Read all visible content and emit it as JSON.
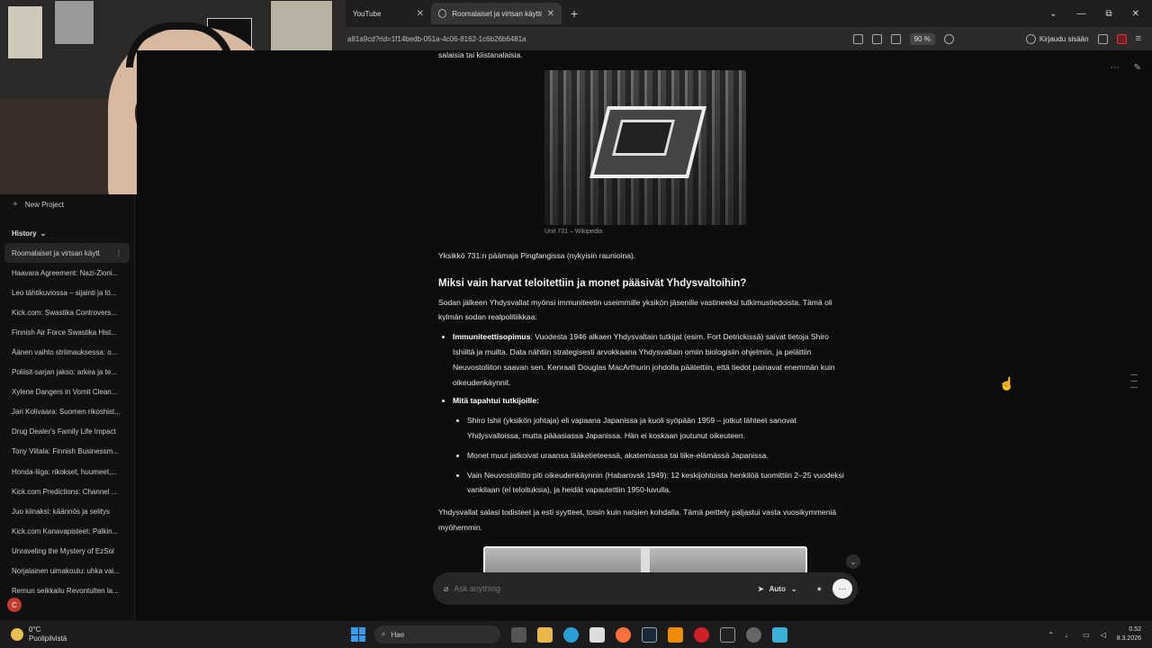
{
  "tabs": [
    {
      "label": "YouTube",
      "close": "✕"
    },
    {
      "label": "Roomalaiset ja virtsan käyttö s…",
      "close": "✕"
    }
  ],
  "newtab": "+",
  "window_controls": {
    "dropdown": "⌄",
    "minimize": "—",
    "maximize": "⧉",
    "close": "✕"
  },
  "address": {
    "url": "a81a9cd?rid=1f14bedb-051a-4c06-8162-1c6b26b6481a",
    "zoom": "90 %",
    "signin": "Kirjaudu sisään"
  },
  "sidebar": {
    "new_project": "New Project",
    "history_label": "History",
    "history_chevron": "⌄",
    "items": [
      {
        "label": "Roomalaiset ja virtsan käytt",
        "active": true
      },
      {
        "label": "Haavara Agreement: Nazi-Zioni..."
      },
      {
        "label": "Leo tähtikuviossa – sijainti ja lö..."
      },
      {
        "label": "Kick.com: Swastika Controvers..."
      },
      {
        "label": "Finnish Air Force Swastika Hist..."
      },
      {
        "label": "Äänen vaihto striimauksessa: o..."
      },
      {
        "label": "Poliisit-sarjan jakso: arkea ja te..."
      },
      {
        "label": "Xylene Dangers in Vomit Clean..."
      },
      {
        "label": "Jari Kolivaara: Suomen rikoshist..."
      },
      {
        "label": "Drug Dealer's Family Life Impact"
      },
      {
        "label": "Tony Viitala: Finnish Businessm..."
      },
      {
        "label": "Honda-liiga: rikokset, huumeet,..."
      },
      {
        "label": "Kick.com Predictions: Channel ..."
      },
      {
        "label": "Juo kiinaksi: käännös ja selitys"
      },
      {
        "label": "Kick.com Kanavapisteet: Palkin..."
      },
      {
        "label": "Unraveling the Mystery of EzSol"
      },
      {
        "label": "Norjalainen uimakoulu: uhka vai..."
      },
      {
        "label": "Remun seikkailu Revontulten la..."
      }
    ],
    "avatar_letter": "C",
    "more": "⋮"
  },
  "article": {
    "top_line": "salaisia tai kiistanalaisia.",
    "caption": "Unit 731 – Wikipedia",
    "p1": "Yksikkö 731:n päämaja Pingfangissa (nykyisin raunioina).",
    "h2": "Miksi vain harvat teloitettiin ja monet pääsivät Yhdysvaltoihin?",
    "p2": "Sodan jälkeen Yhdysvallat myönsi immuniteetin useimmille yksikön jäsenille vastineeksi tutkimustiedoista. Tämä oli kylmän sodan realpolitiikkaa:",
    "b1_title": "Immuniteettisopimus",
    "b1_text": ": Vuodesta 1946 alkaen Yhdysvaltain tutkijat (esim. Fort Detrickissä) saivat tietoja Shiro Ishiiltä ja muilta. Data nähtiin strategisesti arvokkaana Yhdysvaltain omiin biologisiin ohjelmiin, ja pelättiin Neuvostoliiton saavan sen. Kenraali Douglas MacArthurin johdolla päätettiin, että tiedot painavat enemmän kuin oikeudenkäynnit.",
    "b2_title": "Mitä tapahtui tutkijoille",
    "b2_colon": ":",
    "sub": [
      "Shiro Ishii (yksikön johtaja) eli vapaana Japanissa ja kuoli syöpään 1959 – jotkut lähteet sanovat Yhdysvalloissa, mutta pääasiassa Japanissa. Hän ei koskaan joutunut oikeuteen.",
      "Monet muut jatkoivat uraansa lääketieteessä, akatemiassa tai liike-elämässä Japanissa.",
      "Vain Neuvostoliitto piti oikeudenkäynnin (Habarovsk 1949): 12 keskijohtoista henkilöä tuomittiin 2–25 vuodeksi vankilaan (ei teloituksia), ja heidät vapautettiin 1950-luvulla."
    ],
    "p3": "Yhdysvallat salasi todisteet ja esti syytteet, toisin kuin natsien kohdalla. Tämä peittely paljastui vasta vuosikymmeniä myöhemmin."
  },
  "prompt": {
    "placeholder": "Ask anything",
    "mode": "Auto",
    "mode_chevron": "⌄",
    "send": "···"
  },
  "scroll_down": "⌄",
  "taskbar": {
    "temp": "0°C",
    "weather": "Puolipilvistä",
    "search": "Hae",
    "time": "0.52",
    "date": "8.3.2026"
  },
  "colors": {
    "accent_start": "#3a9bf0",
    "avatar": "#c0392b"
  }
}
